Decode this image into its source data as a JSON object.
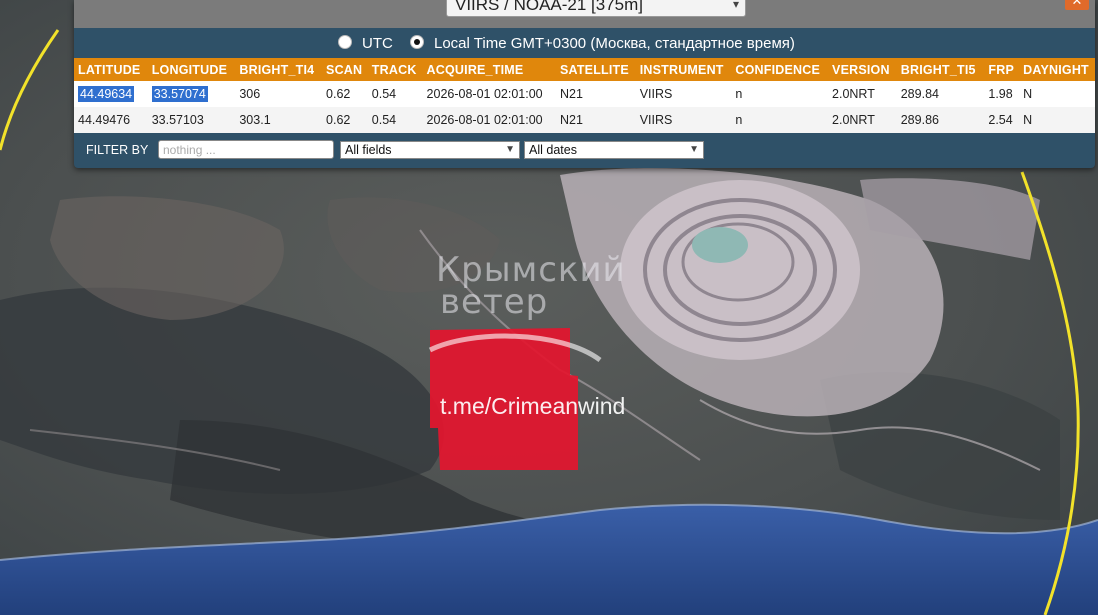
{
  "popup": {
    "source_select": "VIIRS / NOAA-21 [375m]",
    "close_label": "✕",
    "time_options": [
      {
        "label": "UTC",
        "selected": false
      },
      {
        "label": "Local Time GMT+0300 (Москва, стандартное время)",
        "selected": true
      }
    ],
    "table": {
      "columns": [
        "LATITUDE",
        "LONGITUDE",
        "BRIGHT_TI4",
        "SCAN",
        "TRACK",
        "ACQUIRE_TIME",
        "SATELLITE",
        "INSTRUMENT",
        "CONFIDENCE",
        "VERSION",
        "BRIGHT_TI5",
        "FRP",
        "DAYNIGHT"
      ],
      "rows": [
        [
          "44.49634",
          "33.57074",
          "306",
          "0.62",
          "0.54",
          "2026-08-01 02:01:00",
          "N21",
          "VIIRS",
          "n",
          "2.0NRT",
          "289.84",
          "1.98",
          "N"
        ],
        [
          "44.49476",
          "33.57103",
          "303.1",
          "0.62",
          "0.54",
          "2026-08-01 02:01:00",
          "N21",
          "VIIRS",
          "n",
          "2.0NRT",
          "289.86",
          "2.54",
          "N"
        ]
      ]
    },
    "filter": {
      "label": "FILTER BY",
      "placeholder": "nothing ...",
      "field_select": "All fields",
      "date_select": "All dates"
    }
  },
  "watermark": {
    "line1": "Крымский",
    "line2": "ветер",
    "url": "t.me/Crimeanwind"
  },
  "colors": {
    "panel": "#2f5168",
    "header": "#e0870c",
    "hotspot": "#e3152e",
    "boundary": "#f2e22a",
    "sea": "#2c4a8c"
  }
}
